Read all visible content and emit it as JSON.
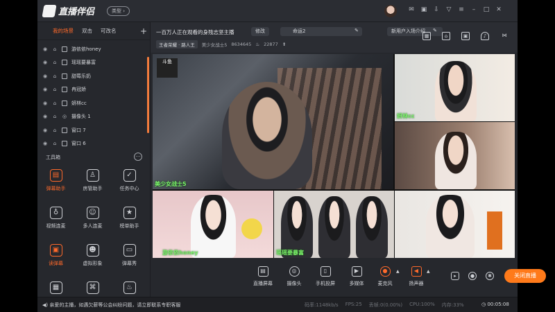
{
  "app": {
    "logo_text": "直播伴侣",
    "type_button": "类型",
    "accent_color": "#ff6a2b"
  },
  "scene_tabs": [
    "我的场景",
    "双击",
    "可改名"
  ],
  "scenes": [
    {
      "label": "游依依honey",
      "kind": "window"
    },
    {
      "label": "瑶瑶要暴富",
      "kind": "window"
    },
    {
      "label": "甜莓乐奶",
      "kind": "window"
    },
    {
      "label": "冉冠娇",
      "kind": "window"
    },
    {
      "label": "妍林cc",
      "kind": "window"
    },
    {
      "label": "摄像头 1",
      "kind": "camera"
    },
    {
      "label": "窗口 7",
      "kind": "window"
    },
    {
      "label": "窗口 6",
      "kind": "window"
    }
  ],
  "toolbox": {
    "title": "工具箱",
    "tools": [
      {
        "label": "弹幕助手",
        "icon": "danmaku-icon",
        "active": true
      },
      {
        "label": "房管助手",
        "icon": "admin-icon",
        "active": false
      },
      {
        "label": "任务中心",
        "icon": "task-icon",
        "active": false
      },
      {
        "label": "视频连麦",
        "icon": "video-link-icon",
        "active": false
      },
      {
        "label": "多人连麦",
        "icon": "multi-link-icon",
        "active": false
      },
      {
        "label": "榜单助手",
        "icon": "ranking-icon",
        "active": false
      },
      {
        "label": "读弹幕",
        "icon": "read-danmaku-icon",
        "active": true
      },
      {
        "label": "虚拟形象",
        "icon": "avatar-icon",
        "active": false
      },
      {
        "label": "弹幕秀",
        "icon": "danmaku-show-icon",
        "active": false
      },
      {
        "label": "",
        "icon": "tool-10-icon",
        "active": false
      },
      {
        "label": "",
        "icon": "tool-11-icon",
        "active": false
      },
      {
        "label": "",
        "icon": "tool-12-icon",
        "active": false
      }
    ]
  },
  "header": {
    "stream_title": "一百万人正在观看的身残志坚主播",
    "edit_label": "修改",
    "pill2_label": "命运2",
    "pill3_label": "新用户入场介绍",
    "rank_tag": "王者荣耀 · 路人王",
    "nickname": "美少女战士5",
    "room_id": "8634645",
    "popularity": "22877"
  },
  "preview_tiles": [
    {
      "label": "美少女战士5"
    },
    {
      "label": "妍林cc"
    },
    {
      "label": ""
    },
    {
      "label": "游依依honey"
    },
    {
      "label": "瑶瑶要暴富"
    },
    {
      "label": ""
    }
  ],
  "controls": [
    {
      "label": "直播屏幕",
      "icon": "screen-icon"
    },
    {
      "label": "摄像头",
      "icon": "camera-icon"
    },
    {
      "label": "手机投屏",
      "icon": "phone-cast-icon"
    },
    {
      "label": "多媒体",
      "icon": "media-icon"
    },
    {
      "label": "麦克风",
      "icon": "microphone-icon"
    },
    {
      "label": "扬声器",
      "icon": "speaker-icon"
    }
  ],
  "close_live_label": "关闭直播",
  "status": {
    "notice": "亲爱的主播，如遇欠薪等公会纠纷问题，请立即联系专职客服",
    "bitrate": "码率:1148kb/s",
    "fps": "FPS:25",
    "drop_frame": "丢帧:0(0.00%)",
    "cpu": "CPU:100%",
    "memory": "内存:33%",
    "timer": "00:05:08"
  }
}
